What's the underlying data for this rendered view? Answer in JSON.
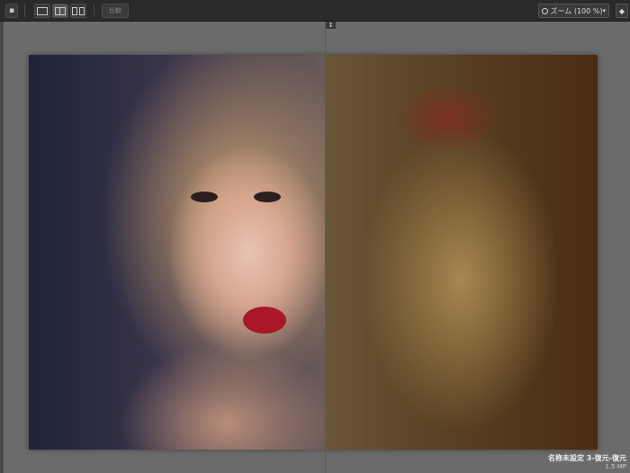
{
  "toolbar": {
    "compare_label": "比較",
    "zoom_label": "ズーム (100 %)",
    "zoom_caret": "▾",
    "pin_glyph": "◆",
    "options_glyph": "▪"
  },
  "divider": {
    "handle_glyph": "↕",
    "color": "#e02020"
  },
  "document": {
    "name": "名称未設定 3-復元-復元",
    "size": "1.5 MP"
  },
  "icons": {
    "single_view": "single-view-icon",
    "split_view": "split-view-icon",
    "side_by_side": "side-by-side-icon",
    "zoom": "magnifier-icon",
    "pin": "pin-icon"
  }
}
